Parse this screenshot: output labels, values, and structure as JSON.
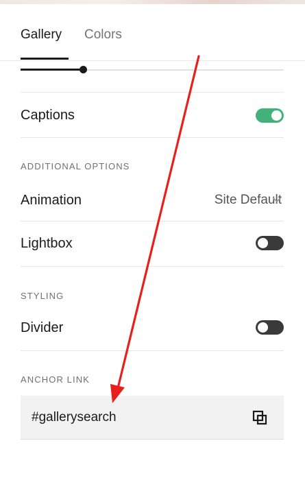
{
  "tabs": [
    {
      "label": "Gallery",
      "active": true
    },
    {
      "label": "Colors",
      "active": false
    }
  ],
  "captions": {
    "label": "Captions",
    "enabled": true
  },
  "sections": {
    "additional_options": "ADDITIONAL OPTIONS",
    "styling": "STYLING",
    "anchor_link": "ANCHOR LINK"
  },
  "animation": {
    "label": "Animation",
    "value": "Site Default"
  },
  "lightbox": {
    "label": "Lightbox",
    "enabled": false
  },
  "divider": {
    "label": "Divider",
    "enabled": false
  },
  "anchor": {
    "value": "#gallerysearch"
  },
  "icons": {
    "chevron": "chevron-down-icon",
    "copy": "copy-icon"
  },
  "colors": {
    "toggle_on": "#43b17a",
    "toggle_off": "#3a3a3a",
    "annotation_arrow": "#e8201b"
  }
}
